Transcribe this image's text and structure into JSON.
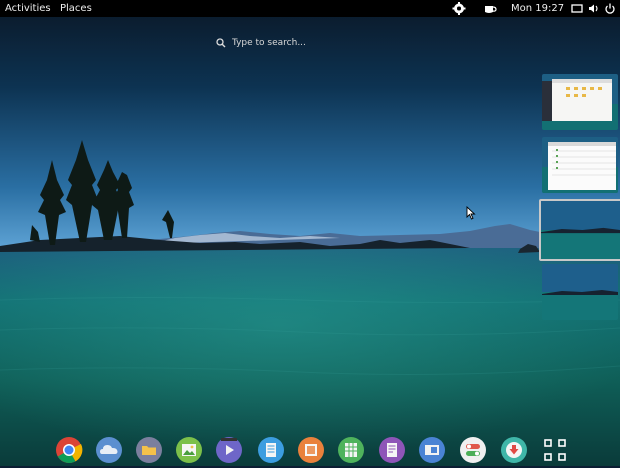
{
  "topbar": {
    "activities_label": "Activities",
    "places_label": "Places",
    "clock": "Mon 19:27",
    "status_icons": [
      "settings-gear-icon",
      "coffee-cup-icon",
      "screen-icon",
      "volume-icon",
      "power-icon"
    ]
  },
  "search": {
    "placeholder": "Type to search..."
  },
  "workspaces": {
    "count": 4,
    "active_index": 2,
    "thumbnails": [
      "workspace-1-file-manager",
      "workspace-2-spreadsheet",
      "workspace-3-empty",
      "workspace-4-empty"
    ]
  },
  "dock": {
    "apps": [
      "chrome-icon",
      "cloud-icon",
      "files-folder-icon",
      "image-viewer-icon",
      "video-player-icon",
      "text-editor-icon",
      "presentation-icon",
      "spreadsheet-icon",
      "document-icon",
      "desktop-preferences-icon",
      "toggle-settings-icon",
      "software-update-icon",
      "show-applications-grid-icon"
    ]
  },
  "colors": {
    "topbar_bg": "#000000",
    "sky_top": "#071a2e",
    "sky_horizon": "#2f7db5",
    "water": "#137070"
  }
}
